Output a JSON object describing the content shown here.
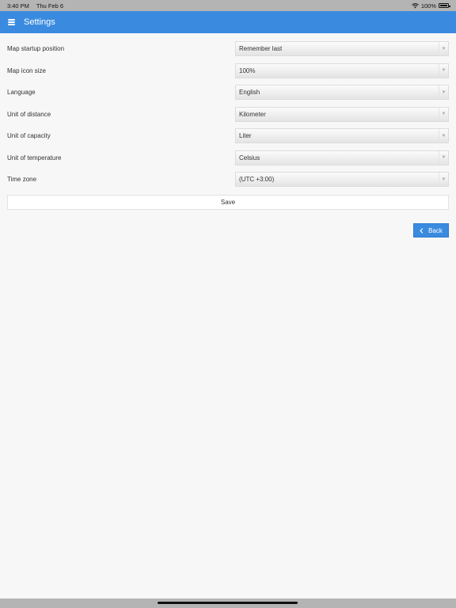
{
  "status_bar": {
    "time": "3:40 PM",
    "date": "Thu Feb 6",
    "battery": "100%",
    "icons": [
      "wifi-icon",
      "battery-icon"
    ]
  },
  "navbar": {
    "title": "Settings",
    "menu_icon": "hamburger-menu-icon"
  },
  "settings": [
    {
      "label": "Map startup position",
      "value": "Remember last"
    },
    {
      "label": "Map icon size",
      "value": "100%"
    },
    {
      "label": "Language",
      "value": "English"
    },
    {
      "label": "Unit of distance",
      "value": "Kilometer"
    },
    {
      "label": "Unit of capacity",
      "value": "Liter"
    },
    {
      "label": "Unit of temperature",
      "value": "Celsius"
    },
    {
      "label": "Time zone",
      "value": "(UTC +3:00)"
    }
  ],
  "actions": {
    "save_label": "Save",
    "back_label": "Back"
  },
  "colors": {
    "accent": "#3a8be0",
    "page_background": "#f7f7f7",
    "status_bar": "#b4b4b4"
  }
}
